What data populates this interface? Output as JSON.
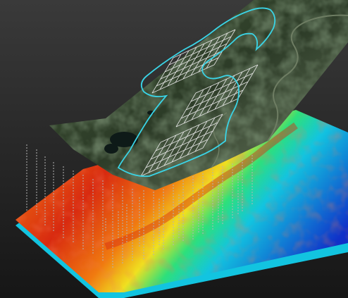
{
  "colors": {
    "background_top": "#3a3a3a",
    "background_bottom": "#161616",
    "terrain_dark": "#2c3b27",
    "terrain_mid": "#3d5233",
    "terrain_light": "#6e7d63",
    "lake": "#0e1a18",
    "boundary_outline": "#3ad4e6",
    "survey_grid": "#e6e6e6",
    "drillhole": "#b4b4b4",
    "heat_low": "#1030c8",
    "heat_mid_low": "#12c4e0",
    "heat_mid": "#2ee07a",
    "heat_mid_high": "#f0e020",
    "heat_high": "#f07a10",
    "heat_peak": "#d82a10"
  },
  "layers": [
    {
      "name": "satellite-terrain-surface"
    },
    {
      "name": "project-boundary-outline"
    },
    {
      "name": "survey-grid"
    },
    {
      "name": "drillholes"
    },
    {
      "name": "subsurface-heatmap-surface"
    }
  ],
  "icons": {
    "drillhole": "dashed-vertical-line"
  }
}
